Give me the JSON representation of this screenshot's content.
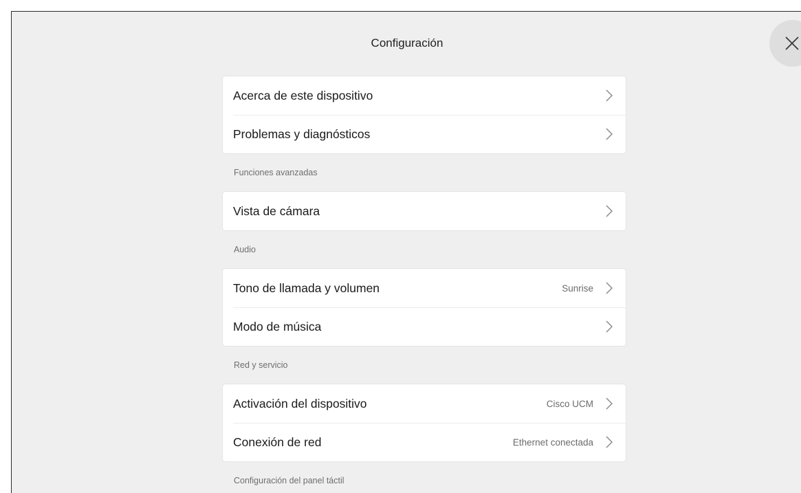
{
  "header": {
    "title": "Configuración",
    "close_icon": "close-icon"
  },
  "groups": [
    {
      "id": "general",
      "section_label": null,
      "items": [
        {
          "label": "Acerca de este dispositivo",
          "value": ""
        },
        {
          "label": "Problemas y diagnósticos",
          "value": ""
        }
      ]
    },
    {
      "id": "advanced",
      "section_label": "Funciones avanzadas",
      "items": [
        {
          "label": "Vista de cámara",
          "value": ""
        }
      ]
    },
    {
      "id": "audio",
      "section_label": "Audio",
      "items": [
        {
          "label": "Tono de llamada y volumen",
          "value": "Sunrise"
        },
        {
          "label": "Modo de música",
          "value": ""
        }
      ]
    },
    {
      "id": "network",
      "section_label": "Red y servicio",
      "items": [
        {
          "label": "Activación del dispositivo",
          "value": "Cisco UCM"
        },
        {
          "label": "Conexión de red",
          "value": "Ethernet conectada"
        }
      ]
    },
    {
      "id": "touch",
      "section_label": "Configuración del panel táctil",
      "items": []
    }
  ],
  "icons": {
    "row_arrow": "chevron-right-icon"
  },
  "colors": {
    "background": "#efefef",
    "card": "#ffffff",
    "close_button": "#dedede"
  }
}
